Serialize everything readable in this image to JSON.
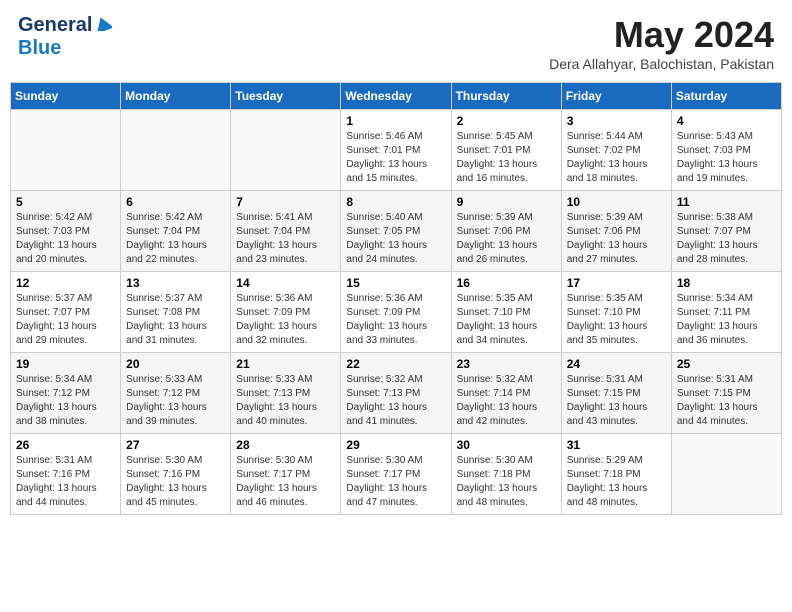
{
  "header": {
    "logo_general": "General",
    "logo_blue": "Blue",
    "month_title": "May 2024",
    "location": "Dera Allahyar, Balochistan, Pakistan"
  },
  "days_of_week": [
    "Sunday",
    "Monday",
    "Tuesday",
    "Wednesday",
    "Thursday",
    "Friday",
    "Saturday"
  ],
  "weeks": [
    [
      {
        "day": "",
        "sunrise": "",
        "sunset": "",
        "daylight": ""
      },
      {
        "day": "",
        "sunrise": "",
        "sunset": "",
        "daylight": ""
      },
      {
        "day": "",
        "sunrise": "",
        "sunset": "",
        "daylight": ""
      },
      {
        "day": "1",
        "sunrise": "Sunrise: 5:46 AM",
        "sunset": "Sunset: 7:01 PM",
        "daylight": "Daylight: 13 hours and 15 minutes."
      },
      {
        "day": "2",
        "sunrise": "Sunrise: 5:45 AM",
        "sunset": "Sunset: 7:01 PM",
        "daylight": "Daylight: 13 hours and 16 minutes."
      },
      {
        "day": "3",
        "sunrise": "Sunrise: 5:44 AM",
        "sunset": "Sunset: 7:02 PM",
        "daylight": "Daylight: 13 hours and 18 minutes."
      },
      {
        "day": "4",
        "sunrise": "Sunrise: 5:43 AM",
        "sunset": "Sunset: 7:03 PM",
        "daylight": "Daylight: 13 hours and 19 minutes."
      }
    ],
    [
      {
        "day": "5",
        "sunrise": "Sunrise: 5:42 AM",
        "sunset": "Sunset: 7:03 PM",
        "daylight": "Daylight: 13 hours and 20 minutes."
      },
      {
        "day": "6",
        "sunrise": "Sunrise: 5:42 AM",
        "sunset": "Sunset: 7:04 PM",
        "daylight": "Daylight: 13 hours and 22 minutes."
      },
      {
        "day": "7",
        "sunrise": "Sunrise: 5:41 AM",
        "sunset": "Sunset: 7:04 PM",
        "daylight": "Daylight: 13 hours and 23 minutes."
      },
      {
        "day": "8",
        "sunrise": "Sunrise: 5:40 AM",
        "sunset": "Sunset: 7:05 PM",
        "daylight": "Daylight: 13 hours and 24 minutes."
      },
      {
        "day": "9",
        "sunrise": "Sunrise: 5:39 AM",
        "sunset": "Sunset: 7:06 PM",
        "daylight": "Daylight: 13 hours and 26 minutes."
      },
      {
        "day": "10",
        "sunrise": "Sunrise: 5:39 AM",
        "sunset": "Sunset: 7:06 PM",
        "daylight": "Daylight: 13 hours and 27 minutes."
      },
      {
        "day": "11",
        "sunrise": "Sunrise: 5:38 AM",
        "sunset": "Sunset: 7:07 PM",
        "daylight": "Daylight: 13 hours and 28 minutes."
      }
    ],
    [
      {
        "day": "12",
        "sunrise": "Sunrise: 5:37 AM",
        "sunset": "Sunset: 7:07 PM",
        "daylight": "Daylight: 13 hours and 29 minutes."
      },
      {
        "day": "13",
        "sunrise": "Sunrise: 5:37 AM",
        "sunset": "Sunset: 7:08 PM",
        "daylight": "Daylight: 13 hours and 31 minutes."
      },
      {
        "day": "14",
        "sunrise": "Sunrise: 5:36 AM",
        "sunset": "Sunset: 7:09 PM",
        "daylight": "Daylight: 13 hours and 32 minutes."
      },
      {
        "day": "15",
        "sunrise": "Sunrise: 5:36 AM",
        "sunset": "Sunset: 7:09 PM",
        "daylight": "Daylight: 13 hours and 33 minutes."
      },
      {
        "day": "16",
        "sunrise": "Sunrise: 5:35 AM",
        "sunset": "Sunset: 7:10 PM",
        "daylight": "Daylight: 13 hours and 34 minutes."
      },
      {
        "day": "17",
        "sunrise": "Sunrise: 5:35 AM",
        "sunset": "Sunset: 7:10 PM",
        "daylight": "Daylight: 13 hours and 35 minutes."
      },
      {
        "day": "18",
        "sunrise": "Sunrise: 5:34 AM",
        "sunset": "Sunset: 7:11 PM",
        "daylight": "Daylight: 13 hours and 36 minutes."
      }
    ],
    [
      {
        "day": "19",
        "sunrise": "Sunrise: 5:34 AM",
        "sunset": "Sunset: 7:12 PM",
        "daylight": "Daylight: 13 hours and 38 minutes."
      },
      {
        "day": "20",
        "sunrise": "Sunrise: 5:33 AM",
        "sunset": "Sunset: 7:12 PM",
        "daylight": "Daylight: 13 hours and 39 minutes."
      },
      {
        "day": "21",
        "sunrise": "Sunrise: 5:33 AM",
        "sunset": "Sunset: 7:13 PM",
        "daylight": "Daylight: 13 hours and 40 minutes."
      },
      {
        "day": "22",
        "sunrise": "Sunrise: 5:32 AM",
        "sunset": "Sunset: 7:13 PM",
        "daylight": "Daylight: 13 hours and 41 minutes."
      },
      {
        "day": "23",
        "sunrise": "Sunrise: 5:32 AM",
        "sunset": "Sunset: 7:14 PM",
        "daylight": "Daylight: 13 hours and 42 minutes."
      },
      {
        "day": "24",
        "sunrise": "Sunrise: 5:31 AM",
        "sunset": "Sunset: 7:15 PM",
        "daylight": "Daylight: 13 hours and 43 minutes."
      },
      {
        "day": "25",
        "sunrise": "Sunrise: 5:31 AM",
        "sunset": "Sunset: 7:15 PM",
        "daylight": "Daylight: 13 hours and 44 minutes."
      }
    ],
    [
      {
        "day": "26",
        "sunrise": "Sunrise: 5:31 AM",
        "sunset": "Sunset: 7:16 PM",
        "daylight": "Daylight: 13 hours and 44 minutes."
      },
      {
        "day": "27",
        "sunrise": "Sunrise: 5:30 AM",
        "sunset": "Sunset: 7:16 PM",
        "daylight": "Daylight: 13 hours and 45 minutes."
      },
      {
        "day": "28",
        "sunrise": "Sunrise: 5:30 AM",
        "sunset": "Sunset: 7:17 PM",
        "daylight": "Daylight: 13 hours and 46 minutes."
      },
      {
        "day": "29",
        "sunrise": "Sunrise: 5:30 AM",
        "sunset": "Sunset: 7:17 PM",
        "daylight": "Daylight: 13 hours and 47 minutes."
      },
      {
        "day": "30",
        "sunrise": "Sunrise: 5:30 AM",
        "sunset": "Sunset: 7:18 PM",
        "daylight": "Daylight: 13 hours and 48 minutes."
      },
      {
        "day": "31",
        "sunrise": "Sunrise: 5:29 AM",
        "sunset": "Sunset: 7:18 PM",
        "daylight": "Daylight: 13 hours and 48 minutes."
      },
      {
        "day": "",
        "sunrise": "",
        "sunset": "",
        "daylight": ""
      }
    ]
  ]
}
